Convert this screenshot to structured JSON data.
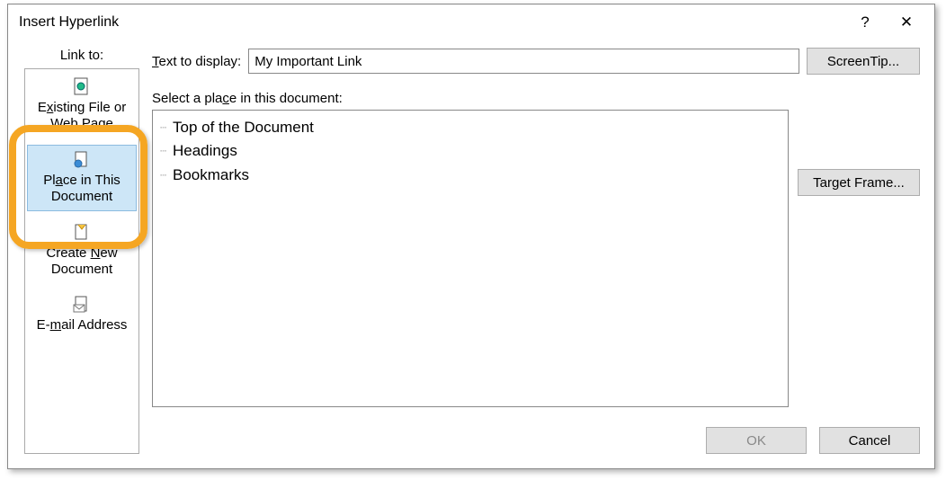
{
  "title": "Insert Hyperlink",
  "sys": {
    "help": "?",
    "close": "✕"
  },
  "linkto": {
    "label_pre": "Link to:",
    "items": [
      {
        "lines": [
          "Existing File or",
          "Web Page"
        ],
        "accel_line0_html": "E<span class='u'>x</span>isting File or"
      },
      {
        "lines": [
          "Place in This",
          "Document"
        ],
        "accel_line0_html": "Pl<span class='u'>a</span>ce in This",
        "selected": true
      },
      {
        "lines": [
          "Create New",
          "Document"
        ],
        "accel_line0_html": "Create <span class='u'>N</span>ew"
      },
      {
        "lines": [
          "E-mail Address"
        ],
        "accel_line0_html": "E-<span class='u'>m</span>ail Address"
      }
    ]
  },
  "text_to_display_label_html": "<span class='u'>T</span>ext to display:",
  "text_to_display_value": "My Important Link",
  "screentip_label": "ScreenTip...",
  "select_label_html": "Select a pla<span class='u'>c</span>e in this document:",
  "tree": [
    "Top of the Document",
    "Headings",
    "Bookmarks"
  ],
  "target_frame_label": "Target Frame...",
  "ok_label": "OK",
  "cancel_label": "Cancel"
}
